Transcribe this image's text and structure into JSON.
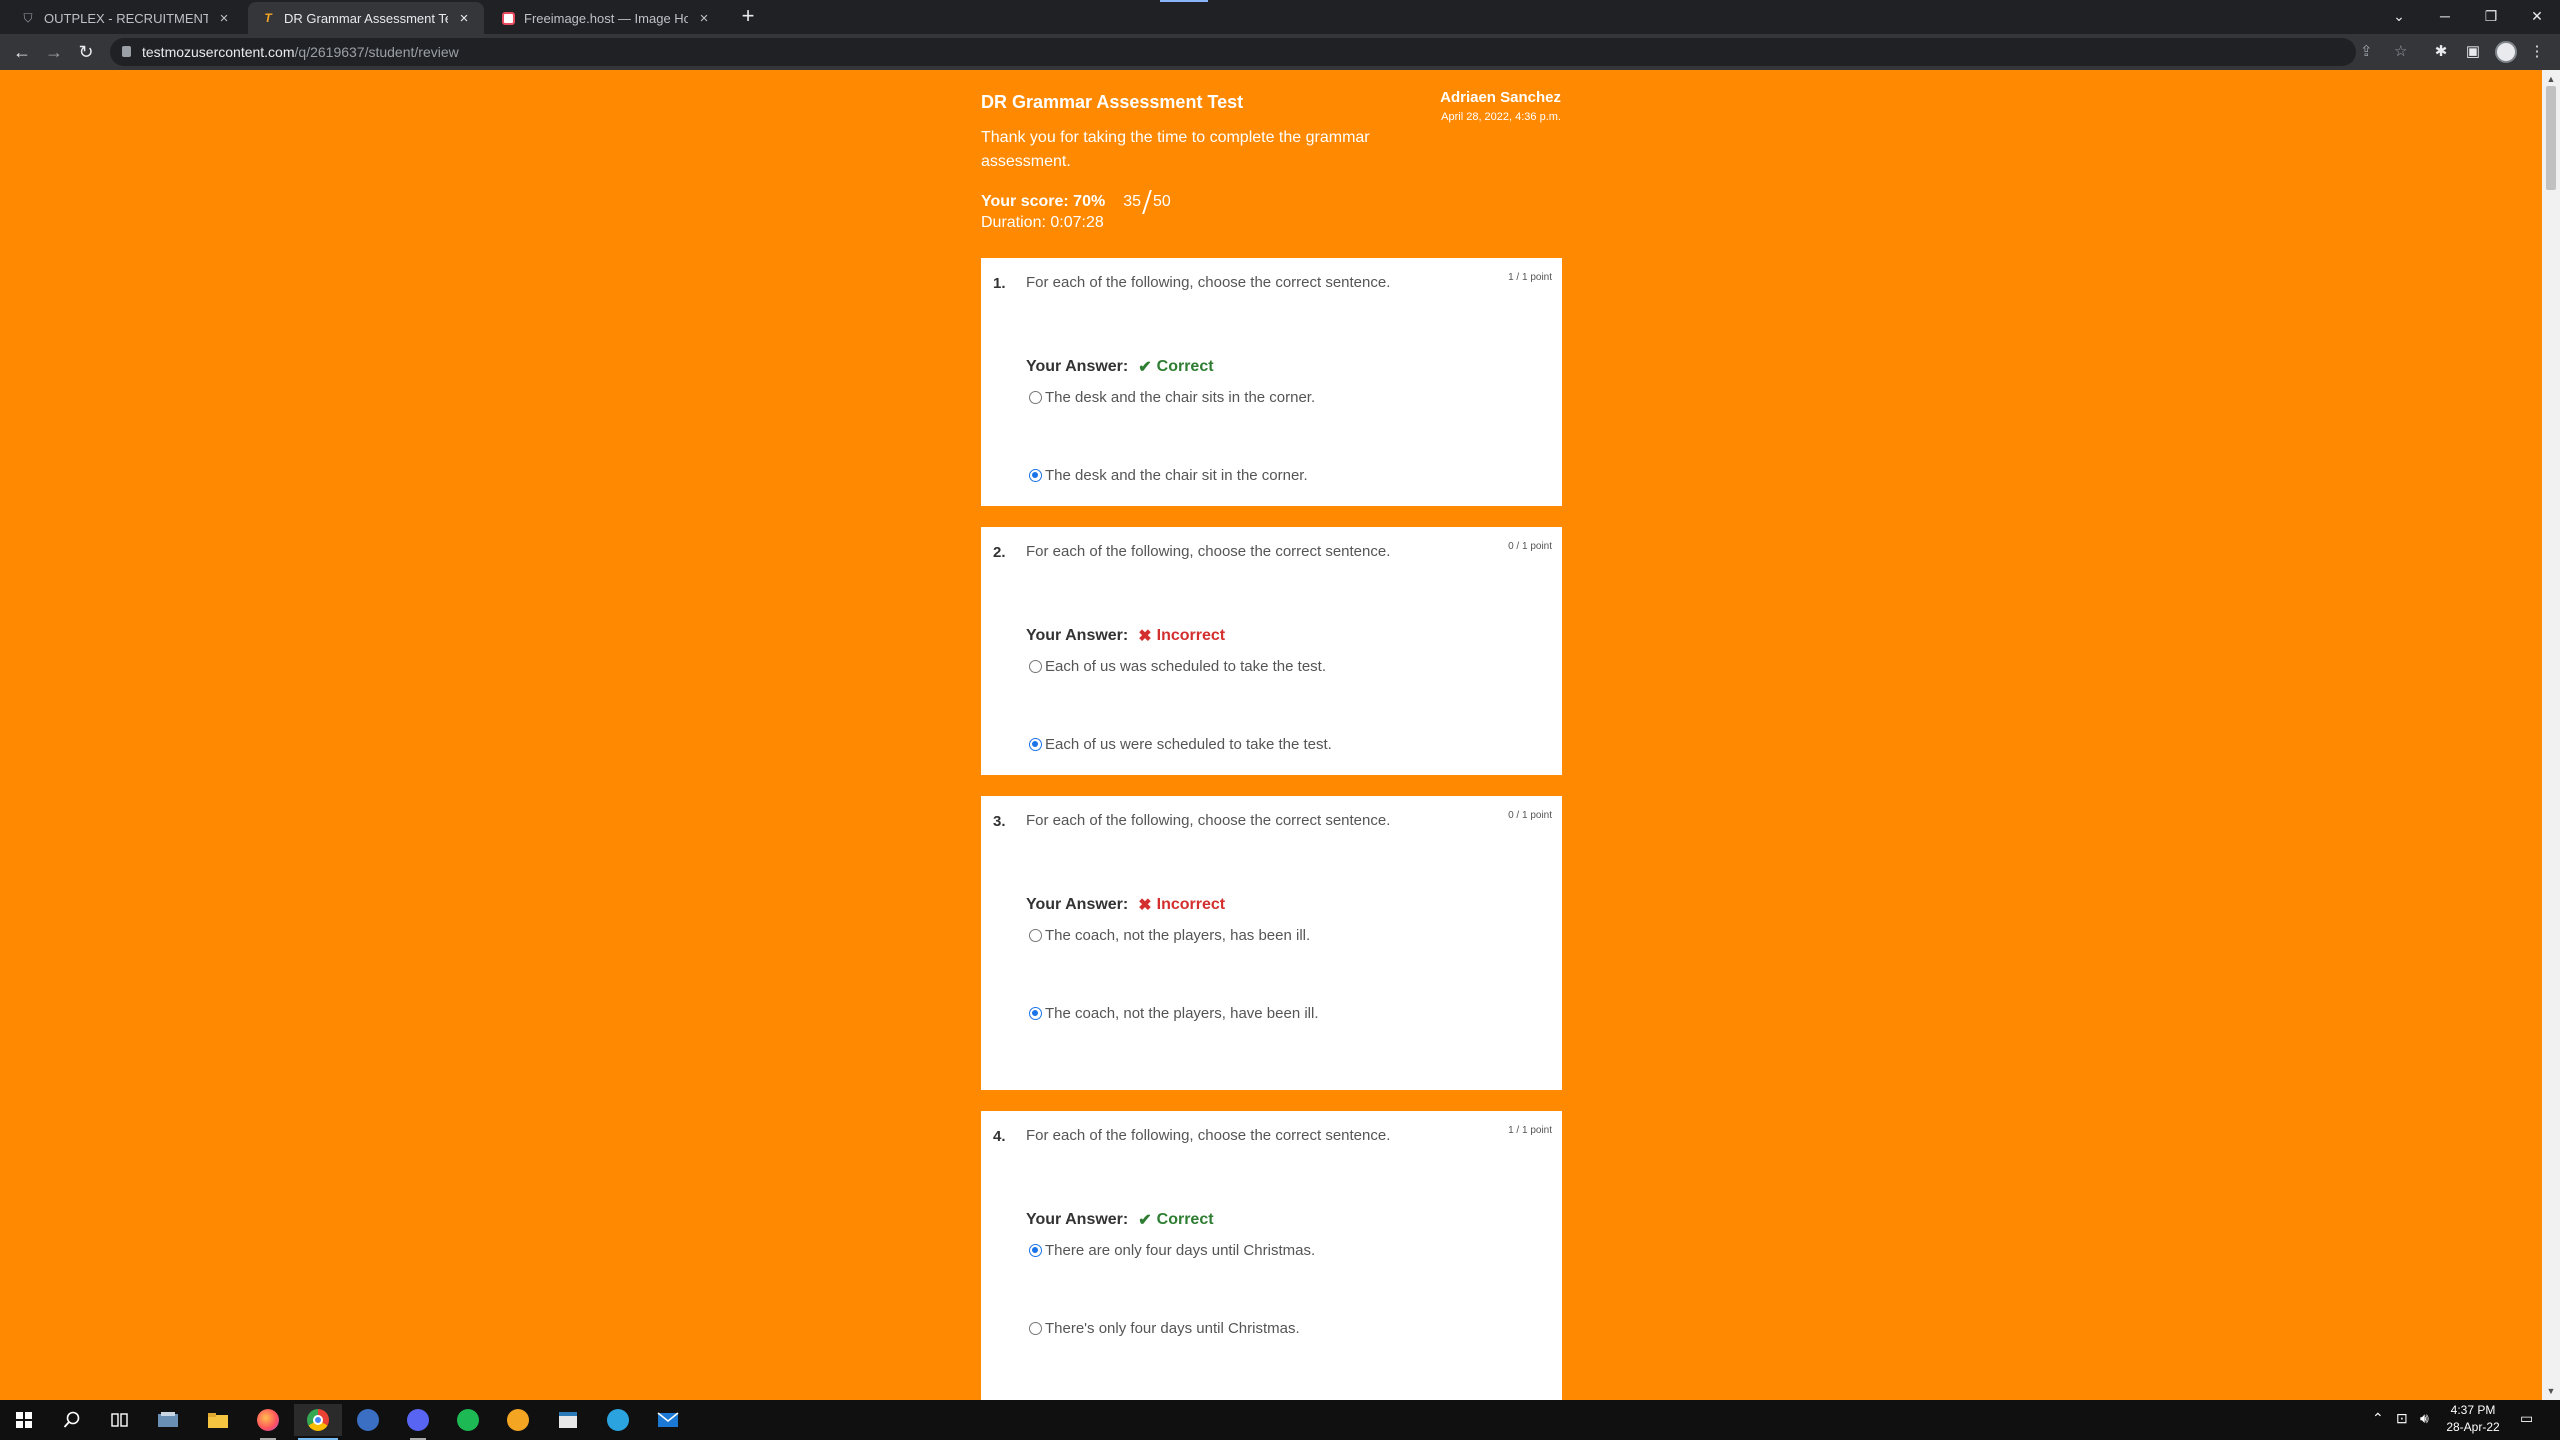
{
  "browser": {
    "tabs": [
      {
        "title": "OUTPLEX - RECRUITMENT ASSES",
        "favicon": "shield-icon",
        "active": false
      },
      {
        "title": "DR Grammar Assessment Test",
        "favicon": "testmoz-icon",
        "active": true
      },
      {
        "title": "Freeimage.host — Image Hosting",
        "favicon": "freeimage-icon",
        "active": false
      }
    ],
    "new_tab": "+",
    "url_host": "testmozusercontent.com",
    "url_path": "/q/2619637/student/review"
  },
  "header": {
    "title": "DR Grammar Assessment Test",
    "student_name": "Adriaen Sanchez",
    "date": "April 28, 2022, 4:36 p.m.",
    "thanks": "Thank you for taking the time to complete the grammar assessment.",
    "score_label": "Your score: 70%",
    "score_numerator": "35",
    "score_denominator": "50",
    "duration": "Duration: 0:07:28"
  },
  "answer_label": "Your Answer:",
  "questions": [
    {
      "number": "1.",
      "text": "For each of the following, choose the correct sentence.",
      "points": "1 / 1 point",
      "result": "Correct",
      "options": [
        {
          "text": "The desk and the chair sits in the corner.",
          "selected": false
        },
        {
          "text": "The desk and the chair sit in the corner.",
          "selected": true
        }
      ]
    },
    {
      "number": "2.",
      "text": "For each of the following, choose the correct sentence.",
      "points": "0 / 1 point",
      "result": "Incorrect",
      "options": [
        {
          "text": "Each of us was scheduled to take the test.",
          "selected": false
        },
        {
          "text": "Each of us were scheduled to take the test.",
          "selected": true
        }
      ]
    },
    {
      "number": "3.",
      "text": "For each of the following, choose the correct sentence.",
      "points": "0 / 1 point",
      "result": "Incorrect",
      "options": [
        {
          "text": "The coach, not the players, has been ill.",
          "selected": false
        },
        {
          "text": "The coach, not the players, have been ill.",
          "selected": true
        }
      ]
    },
    {
      "number": "4.",
      "text": "For each of the following, choose the correct sentence.",
      "points": "1 / 1 point",
      "result": "Correct",
      "options": [
        {
          "text": "There are only four days until Christmas.",
          "selected": true
        },
        {
          "text": "There's only four days until Christmas.",
          "selected": false
        }
      ]
    }
  ],
  "taskbar": {
    "apps": [
      "start-icon",
      "search-icon",
      "task-view-icon",
      "explorer-icon",
      "file-manager-icon",
      "firefox-icon",
      "chrome-icon",
      "app-icon",
      "discord-icon",
      "spotify-icon",
      "emoji-app-icon",
      "notepad-icon",
      "telegram-icon",
      "mail-icon"
    ],
    "time": "4:37 PM",
    "date": "28-Apr-22"
  },
  "colors": {
    "page_bg": "#ff8900",
    "correct": "#2e7d32",
    "incorrect": "#d32f2f",
    "radio_selected": "#1a73e8"
  }
}
